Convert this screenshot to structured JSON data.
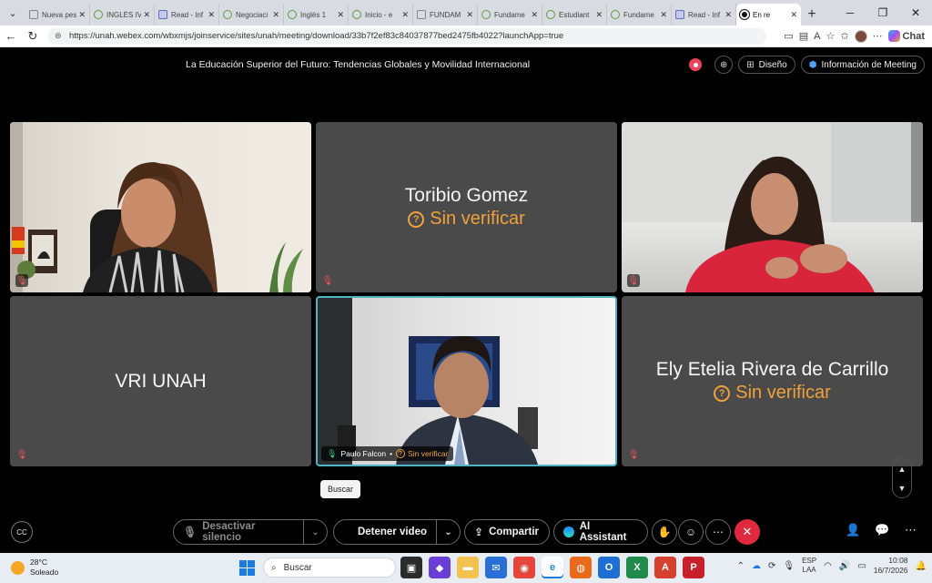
{
  "browser": {
    "tabs": [
      {
        "title": "Nueva pestaña",
        "icon": "doc"
      },
      {
        "title": "INGLÉS IV",
        "icon": "leaf"
      },
      {
        "title": "Read - Inf",
        "icon": "read"
      },
      {
        "title": "Negociaci",
        "icon": "leaf"
      },
      {
        "title": "Inglés 1",
        "icon": "leaf"
      },
      {
        "title": "Inicio - e",
        "icon": "leaf"
      },
      {
        "title": "FUNDAM",
        "icon": "doc"
      },
      {
        "title": "Fundame",
        "icon": "leaf"
      },
      {
        "title": "Estudiant",
        "icon": "leaf"
      },
      {
        "title": "Fundame",
        "icon": "leaf"
      },
      {
        "title": "Read - Inf",
        "icon": "read"
      },
      {
        "title": "En re",
        "icon": "webex",
        "active": true
      }
    ],
    "url": "https://unah.webex.com/wbxmjs/joinservice/sites/unah/meeting/download/33b7f2ef83c84037877bed2475fb4022?launchApp=true",
    "chat_label": "Chat"
  },
  "meeting": {
    "title": "La Educación Superior del Futuro: Tendencias Globales y Movilidad Internacional",
    "layout_label": "Diseño",
    "info_label": "Información de Meeting",
    "participants": [
      {
        "type": "video",
        "name": ""
      },
      {
        "type": "name",
        "name": "Toribio Gomez",
        "status": "Sin verificar"
      },
      {
        "type": "video",
        "name": ""
      },
      {
        "type": "name",
        "name": "VRI UNAH",
        "status": ""
      },
      {
        "type": "video",
        "name": "Paulo Falcon",
        "status": "Sin verificar",
        "active": true
      },
      {
        "type": "name",
        "name": "Ely Etelia Rivera de Carrillo",
        "status": "Sin verificar"
      }
    ],
    "controls": {
      "unmute": "Desactivar silencio",
      "stop_video": "Detener video",
      "share": "Compartir",
      "ai_assistant": "AI Assistant"
    },
    "tooltip": "Buscar"
  },
  "taskbar": {
    "temperature": "28°C",
    "weather": "Soleado",
    "search_placeholder": "Buscar",
    "lang_line1": "ESP",
    "lang_line2": "LAA",
    "time": "10:08",
    "date": "16/7/2026"
  }
}
